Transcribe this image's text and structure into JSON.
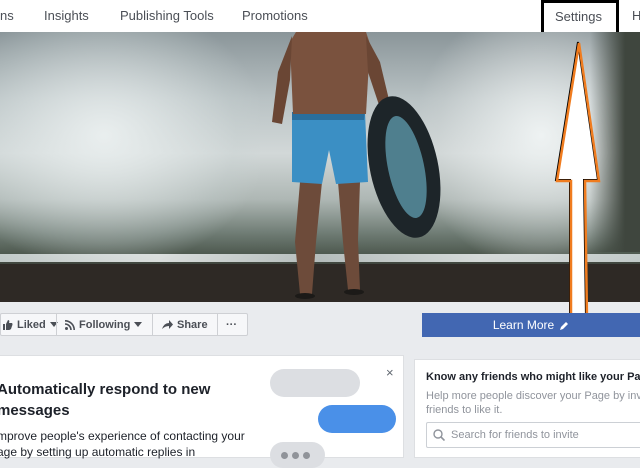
{
  "nav": {
    "items": [
      "ns",
      "Insights",
      "Publishing Tools",
      "Promotions"
    ],
    "settings": "Settings",
    "cut_right": "H"
  },
  "actions": {
    "liked": "Liked",
    "following": "Following",
    "share": "Share",
    "more": "···"
  },
  "cta": {
    "label": "Learn More"
  },
  "auto_reply": {
    "title_line1": "Automatically respond to new",
    "title_line2": "messages",
    "body_line1": "mprove people's experience of contacting your",
    "body_line2": "age by setting up automatic replies in",
    "close": "×"
  },
  "friends": {
    "title": "Know any friends who might like your Page",
    "subtitle_line1": "Help more people discover your Page by inviti",
    "subtitle_line2": "friends to like it.",
    "search_placeholder": "Search for friends to invite"
  },
  "colors": {
    "accent": "#4267b2",
    "annotation_arrow": "#f07c1f",
    "bubble_blue": "#4a90e8"
  }
}
